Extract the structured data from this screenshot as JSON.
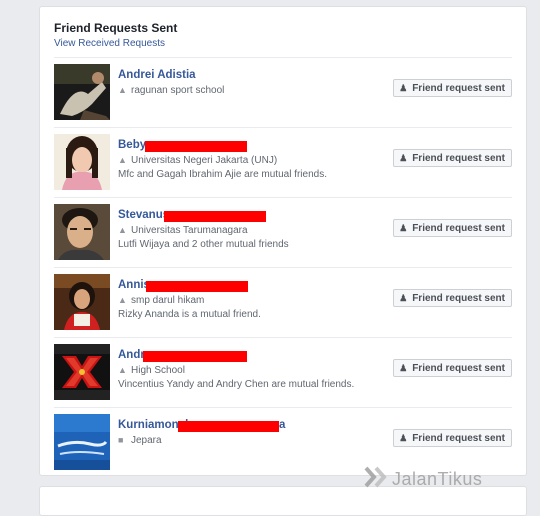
{
  "panel": {
    "title": "Friend Requests Sent",
    "link": "View Received Requests"
  },
  "button_label": "Friend request sent",
  "rows": [
    {
      "name": "Andrei Adistia",
      "line1": "ragunan sport school",
      "line1_icon": "graduation-cap-icon",
      "line2": ""
    },
    {
      "name": "Beby",
      "line1": "Universitas Negeri Jakarta (UNJ)",
      "line1_icon": "graduation-cap-icon",
      "line2": "Mfc and Gagah Ibrahim Ajie are mutual friends."
    },
    {
      "name": "Stevanus",
      "line1": "Universitas Tarumanagara",
      "line1_icon": "graduation-cap-icon",
      "line2": "Lutfi Wijaya and 2 other mutual friends"
    },
    {
      "name": "Annis",
      "line1": "smp darul hikam",
      "line1_icon": "graduation-cap-icon",
      "line2": "Rizky Ananda is a mutual friend."
    },
    {
      "name": "Andr",
      "line1": "High School",
      "line1_icon": "graduation-cap-icon",
      "line2": "Vincentius Yandy and Andry Chen are mutual friends."
    },
    {
      "name": "Kurniamonel",
      "name_suffix": "a",
      "line1": "Jepara",
      "line1_icon": "building-icon",
      "line2": ""
    }
  ],
  "watermark": "JalanTikus",
  "colors": {
    "link": "#365899",
    "redaction": "#ff0000",
    "background": "#e9ebee"
  }
}
